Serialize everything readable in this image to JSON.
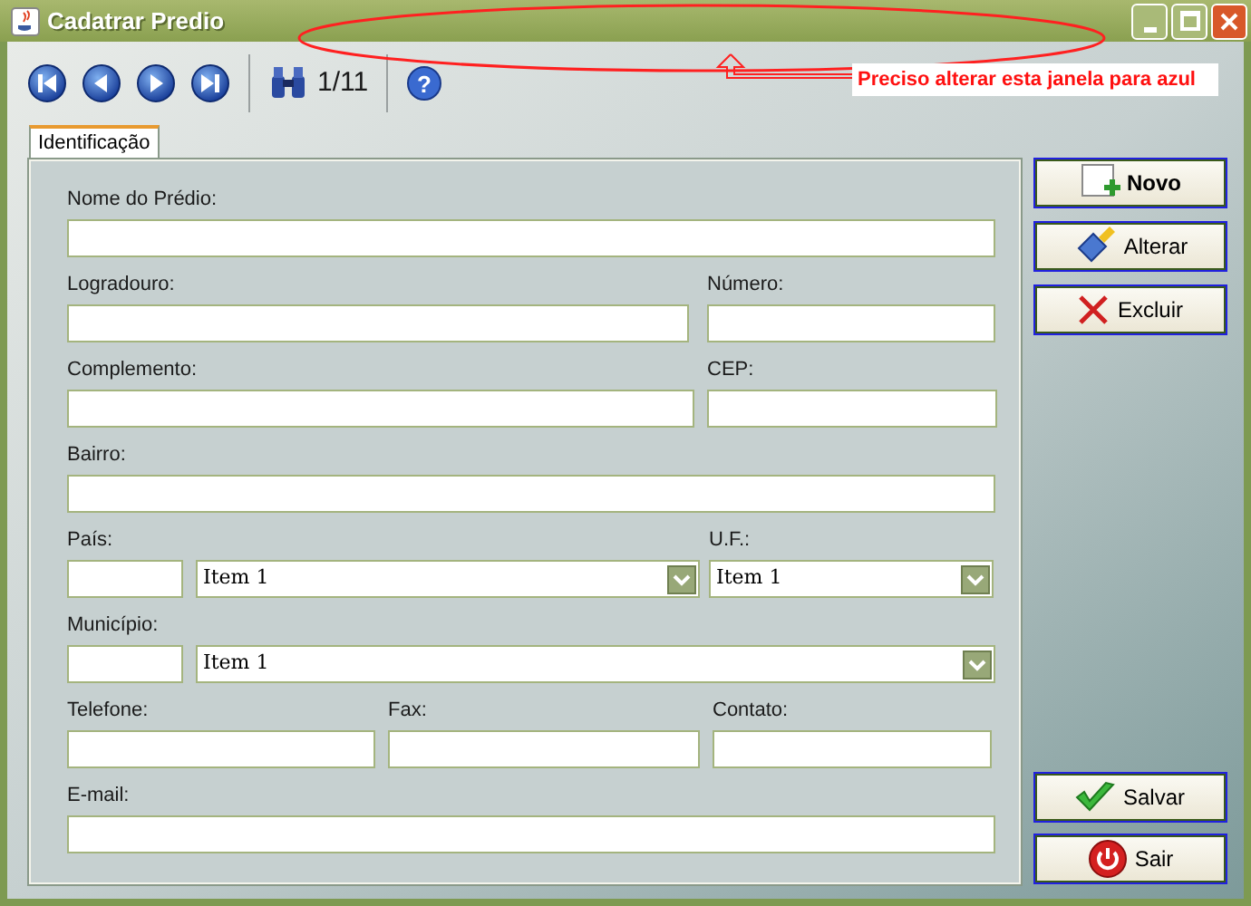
{
  "window": {
    "title": "Cadatrar Predio"
  },
  "toolbar": {
    "record_counter": "1/11",
    "help_glyph": "?"
  },
  "annotation": {
    "text": "Preciso alterar esta janela para azul"
  },
  "tabs": [
    {
      "label": "Identificação",
      "selected": true
    }
  ],
  "form": {
    "rows": [
      {
        "columns": [
          {
            "label": "Nome do Prédio:",
            "controls": [
              {
                "kind": "text"
              }
            ]
          }
        ]
      },
      {
        "columns": [
          {
            "label": "Logradouro:",
            "controls": [
              {
                "kind": "text"
              }
            ]
          },
          {
            "label": "Número:",
            "controls": [
              {
                "kind": "text"
              }
            ]
          }
        ]
      },
      {
        "columns": [
          {
            "label": "Complemento:",
            "controls": [
              {
                "kind": "text"
              }
            ]
          },
          {
            "label": "CEP:",
            "controls": [
              {
                "kind": "text"
              }
            ]
          }
        ]
      },
      {
        "columns": [
          {
            "label": "Bairro:",
            "controls": [
              {
                "kind": "text"
              }
            ]
          }
        ]
      },
      {
        "columns": [
          {
            "label": "País:",
            "controls": [
              {
                "kind": "code"
              },
              {
                "kind": "combo",
                "value": "Item 1"
              }
            ]
          },
          {
            "label": "U.F.:",
            "controls": [
              {
                "kind": "combo",
                "value": "Item 1"
              }
            ]
          }
        ]
      },
      {
        "columns": [
          {
            "label": "Município:",
            "controls": [
              {
                "kind": "code"
              },
              {
                "kind": "combo",
                "value": "Item 1"
              }
            ]
          }
        ]
      },
      {
        "columns": [
          {
            "label": "Telefone:",
            "controls": [
              {
                "kind": "text"
              }
            ]
          },
          {
            "label": "Fax:",
            "controls": [
              {
                "kind": "text"
              }
            ]
          },
          {
            "label": "Contato:",
            "controls": [
              {
                "kind": "text"
              }
            ]
          }
        ]
      },
      {
        "columns": [
          {
            "label": "E-mail:",
            "controls": [
              {
                "kind": "text"
              }
            ]
          }
        ]
      }
    ]
  },
  "actions_top": [
    {
      "label": "Novo",
      "kind": "new",
      "primary": true
    },
    {
      "label": "Alterar",
      "kind": "edit",
      "primary": false
    },
    {
      "label": "Excluir",
      "kind": "delete",
      "primary": false
    }
  ],
  "actions_bottom": [
    {
      "label": "Salvar",
      "kind": "save",
      "primary": false
    },
    {
      "label": "Sair",
      "kind": "exit",
      "primary": false
    }
  ]
}
